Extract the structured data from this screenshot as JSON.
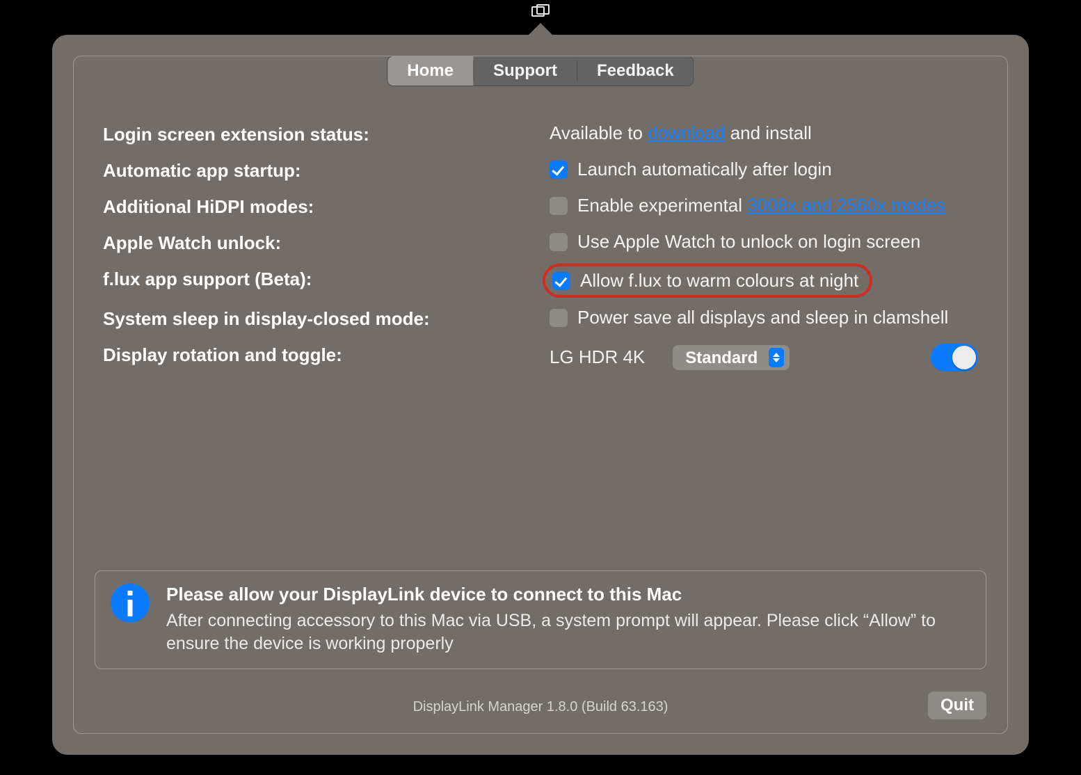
{
  "tabs": {
    "home": "Home",
    "support": "Support",
    "feedback": "Feedback",
    "active": "home"
  },
  "rows": {
    "login_ext": {
      "label": "Login screen extension status:",
      "prefix": "Available to ",
      "link": "download",
      "suffix": " and install"
    },
    "autostart": {
      "label": "Automatic app startup:",
      "cb_label": "Launch automatically after login",
      "checked": true
    },
    "hidpi": {
      "label": "Additional HiDPI modes:",
      "cb_prefix": "Enable experimental ",
      "link": "3008x and 2560x modes",
      "checked": false
    },
    "watch": {
      "label": "Apple Watch unlock:",
      "cb_label": "Use Apple Watch to unlock on login screen",
      "checked": false
    },
    "flux": {
      "label": "f.lux app support (Beta):",
      "cb_label": "Allow f.lux to warm colours at night",
      "checked": true
    },
    "sleep": {
      "label": "System sleep in display-closed mode:",
      "cb_label": "Power save all displays and sleep in clamshell",
      "checked": false
    },
    "rotation": {
      "label": "Display rotation and toggle:",
      "display_name": "LG HDR 4K",
      "select_value": "Standard",
      "toggle_on": true
    }
  },
  "info": {
    "title": "Please allow your DisplayLink device to connect to this Mac",
    "body": "After connecting accessory to this Mac via USB, a system prompt will appear. Please click “Allow” to ensure the device is working properly"
  },
  "footer": {
    "version": "DisplayLink Manager 1.8.0 (Build 63.163)",
    "quit": "Quit"
  }
}
